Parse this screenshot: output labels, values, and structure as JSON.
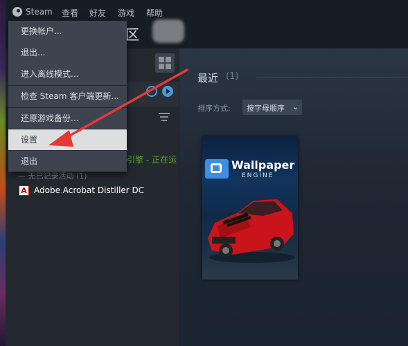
{
  "menubar": {
    "items": [
      "Steam",
      "查看",
      "好友",
      "游戏",
      "帮助"
    ]
  },
  "header": {
    "section_fragment": "区"
  },
  "dropdown": {
    "items": [
      "更换帐户...",
      "退出...",
      "进入离线模式...",
      "检查 Steam 客户端更新...",
      "还原游戏备份...",
      "设置",
      "退出"
    ],
    "highlighted": "设置"
  },
  "library": {
    "status_fragment": "引擎 - 正在运",
    "group_header": "— 无已记录活动 (1)",
    "app_icon_glyph": "A",
    "apps": [
      "Adobe Acrobat Distiller DC"
    ]
  },
  "recent": {
    "title": "最近",
    "count": "(1)",
    "sort_label": "排序方式:",
    "sort_value": "按字母顺序",
    "sort_chevron": "⌄"
  },
  "game_card": {
    "title": "Wallpaper",
    "subtitle": "ENGINE"
  },
  "colors": {
    "menubar_bg": "#171d25",
    "panel_bg": "#24282f",
    "dropdown_bg": "#3d4450",
    "highlight_bg": "#dcdedf",
    "accent_blue": "#4c9ad6",
    "status_green": "#5ba32b",
    "arrow_red": "#e53935"
  },
  "icons": [
    "steam-logo-icon",
    "grid-view-icon",
    "clock-icon",
    "play-icon",
    "filter-icon",
    "pdf-icon",
    "wallpaper-engine-logo-icon",
    "chevron-down-icon",
    "annotation-arrow"
  ]
}
